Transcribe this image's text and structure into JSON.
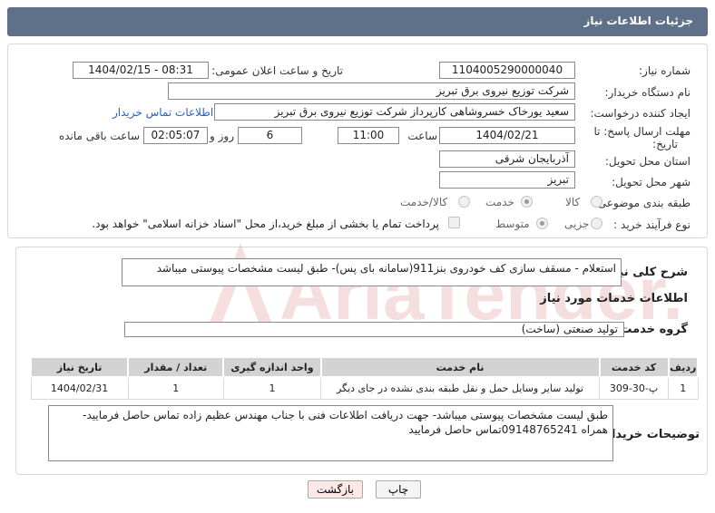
{
  "header": {
    "title": "جزئیات اطلاعات نیاز"
  },
  "form": {
    "need_number_label": "شماره نیاز:",
    "need_number": "1104005290000040",
    "announce_label": "تاریخ و ساعت اعلان عمومی:",
    "announce_value": "1404/02/15 - 08:31",
    "buyer_label": "نام دستگاه خریدار:",
    "buyer_value": "شرکت توزیع نیروی برق تبریز",
    "creator_label": "ایجاد کننده درخواست:",
    "creator_value": "سعید یورخاک خسروشاهی کارپرداز شرکت توزیع نیروی برق تبریز",
    "contact_link": "اطلاعات تماس خریدار",
    "deadline_label_1": "مهلت ارسال پاسخ: تا",
    "deadline_label_2": "تاریخ:",
    "deadline_date": "1404/02/21",
    "hour_label": "ساعت",
    "deadline_hour": "11:00",
    "days_value": "6",
    "days_label": "روز و",
    "remaining_value": "02:05:07",
    "remaining_label": "ساعت باقی مانده",
    "province_label": "استان محل تحویل:",
    "province_value": "آذربایجان شرقی",
    "city_label": "شهر محل تحویل:",
    "city_value": "تبریز",
    "category_label": "طبقه بندی موضوعی:",
    "category_options": [
      "کالا",
      "خدمت",
      "کالا/خدمت"
    ],
    "category_selected": "خدمت",
    "purchase_label": "نوع فرآیند خرید :",
    "purchase_options": [
      "جزیی",
      "متوسط"
    ],
    "purchase_selected": "متوسط",
    "payment_note": "پرداخت تمام یا بخشی از مبلغ خرید،از محل \"اسناد خزانه اسلامی\" خواهد بود."
  },
  "summary": {
    "label": "شرح کلی نیاز:",
    "value": "استعلام - مسقف سازی کف خودروی بنز911(سامانه بای پس)- طبق لیست مشخصات پیوستی میباشد"
  },
  "services": {
    "section_title": "اطلاعات خدمات مورد نیاز",
    "group_label": "گروه خدمت:",
    "group_value": "تولید صنعتی (ساخت)",
    "columns": [
      "ردیف",
      "کد خدمت",
      "نام خدمت",
      "واحد اندازه گیری",
      "تعداد / مقدار",
      "تاریخ نیاز"
    ],
    "rows": [
      [
        "1",
        "پ-30-309",
        "تولید سایر وسایل حمل و نقل طبقه بندی نشده در جای دیگر",
        "1",
        "1",
        "1404/02/31"
      ]
    ]
  },
  "buyer_notes": {
    "label": "توضیحات خریدار:",
    "value": "طبق لیست مشخصات پیوستی میباشد- جهت دریافت اطلاعات فنی با جناب مهندس عظیم زاده تماس حاصل فرمایید- همراه 09148765241تماس حاصل فرمایید"
  },
  "buttons": {
    "print": "چاپ",
    "back": "بازگشت"
  },
  "watermark": {
    "text": "AriaTender.net"
  },
  "colors": {
    "header": "#5f7089",
    "link": "#2a62c9",
    "watermark": "#e2a2a2",
    "back_button": "#fde8e8"
  }
}
